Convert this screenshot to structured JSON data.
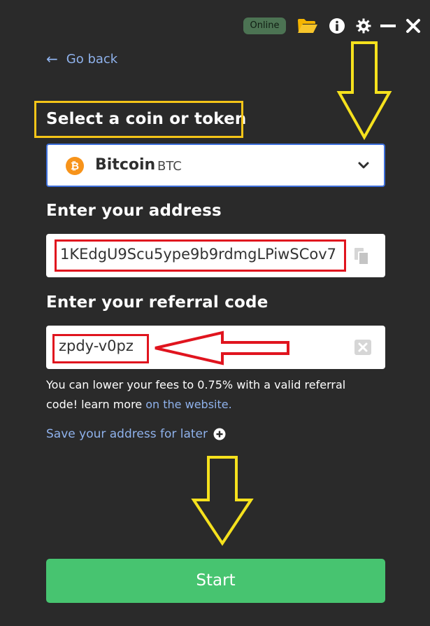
{
  "header": {
    "status": "Online"
  },
  "nav": {
    "back_label": "Go back"
  },
  "coin_section": {
    "title": "Select a coin or token",
    "selected_name": "Bitcoin",
    "selected_symbol": "BTC"
  },
  "address_section": {
    "title": "Enter your address",
    "value": "1KEdgU9Scu5ype9b9rdmgLPiwSCov7"
  },
  "referral_section": {
    "title": "Enter your referral code",
    "value": "zpdy-v0pz",
    "note_text": "You can lower your fees to 0.75% with a valid referral code! learn more",
    "note_link": "on the website."
  },
  "save_link": "Save your address for later",
  "start_label": "Start",
  "colors": {
    "background": "#2a2a2a",
    "accent_link": "#8fb2ec",
    "start_button": "#47c470",
    "annotation_yellow": "#f5c518",
    "annotation_red": "#e0141e",
    "bitcoin": "#f7931a"
  },
  "icons": {
    "open_folder": "folder-icon",
    "info": "info-icon",
    "settings": "gear-icon",
    "minimize": "minimize-icon",
    "close": "close-icon",
    "copy": "copy-icon",
    "clear": "clear-icon",
    "add": "plus-circle-icon",
    "dropdown": "chevron-down-icon"
  }
}
